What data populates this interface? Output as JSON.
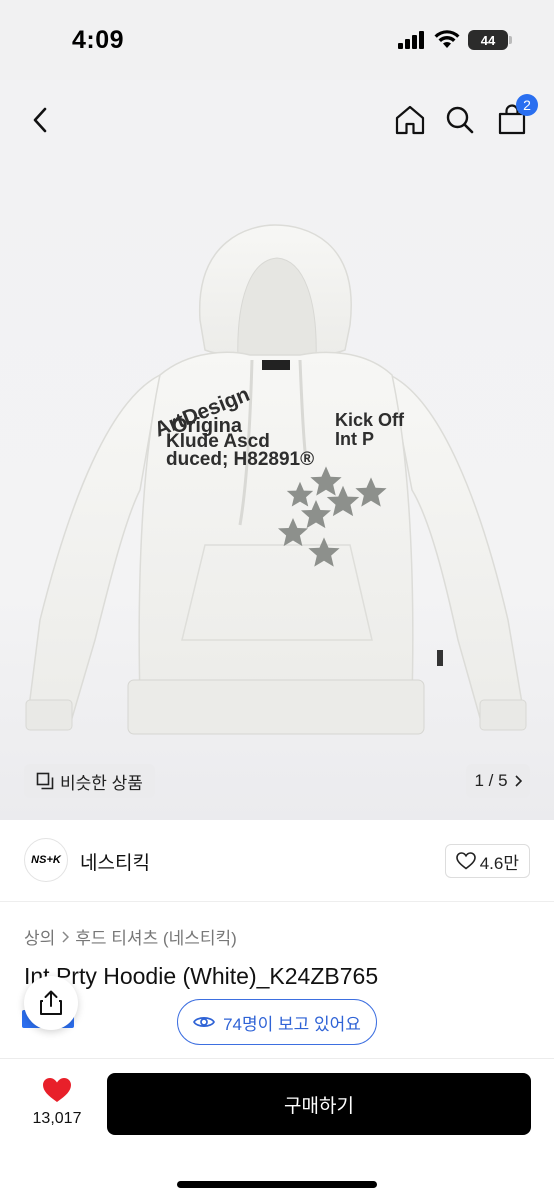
{
  "status_bar": {
    "time": "4:09",
    "battery": "44"
  },
  "header": {
    "cart_count": "2"
  },
  "gallery": {
    "similar_label": "비슷한 상품",
    "page_indicator": "1 / 5",
    "print_text": [
      "ArtDesign",
      "Origina",
      "Klude Ascd",
      "duced; H82891®",
      "Kick Off",
      "Int P"
    ]
  },
  "brand": {
    "logo_text": "NS+K",
    "name": "네스티킥",
    "rating": "4.6만"
  },
  "breadcrumb": {
    "level1": "상의",
    "level2": "후드 티셔츠 (네스티킥)"
  },
  "product": {
    "title": "Int Prty Hoodie (White)_K24ZB765"
  },
  "viewers": {
    "label": "74명이 보고 있어요"
  },
  "bottom_bar": {
    "like_count": "13,017",
    "buy_label": "구매하기"
  },
  "colors": {
    "accent_blue": "#2f63d6",
    "badge_blue": "#2a6ff0",
    "heart_red": "#e8202a",
    "buy_black": "#000000"
  },
  "icons": [
    "back-icon",
    "home-icon",
    "search-icon",
    "cart-icon",
    "heart-icon",
    "share-icon",
    "eye-icon"
  ]
}
